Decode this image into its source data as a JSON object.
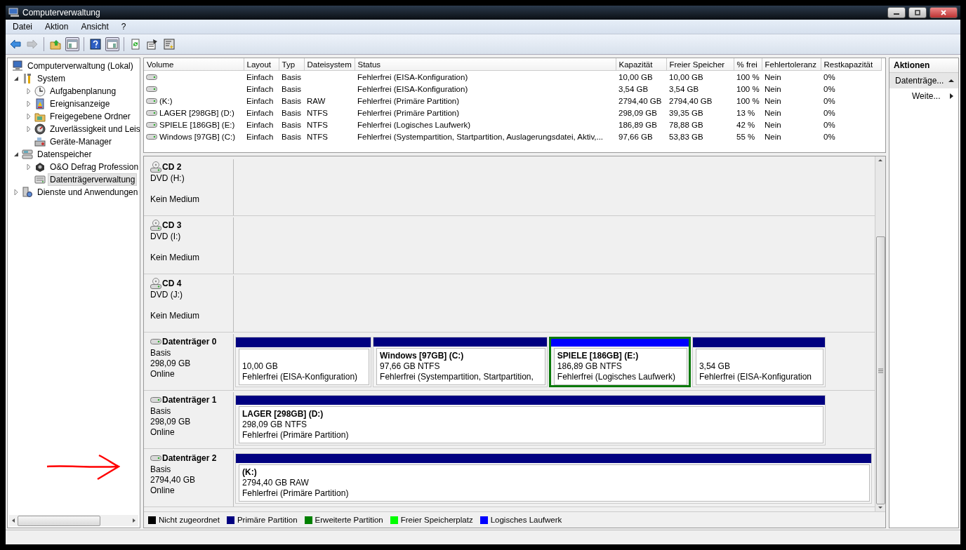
{
  "window": {
    "title": "Computerverwaltung"
  },
  "menu": [
    "Datei",
    "Aktion",
    "Ansicht",
    "?"
  ],
  "toolbar": [
    {
      "pressed": false,
      "disabled": false
    },
    {
      "pressed": false,
      "disabled": true
    },
    {
      "pressed": false,
      "disabled": false
    },
    {
      "pressed": true,
      "disabled": false
    },
    {
      "pressed": false,
      "disabled": false
    },
    {
      "pressed": true,
      "disabled": false
    },
    {
      "pressed": false,
      "disabled": false
    },
    {
      "pressed": false,
      "disabled": false
    },
    {
      "pressed": false,
      "disabled": false
    }
  ],
  "tree": [
    {
      "label": "Computerverwaltung (Lokal)",
      "selected": false,
      "children": [
        {
          "label": "System",
          "expanded": true,
          "selected": false,
          "children": [
            {
              "label": "Aufgabenplanung",
              "expanded": false,
              "selected": false
            },
            {
              "label": "Ereignisanzeige",
              "expanded": false,
              "selected": false
            },
            {
              "label": "Freigegebene Ordner",
              "expanded": false,
              "selected": false
            },
            {
              "label": "Zuverlässigkeit und Leis",
              "expanded": false,
              "selected": false
            },
            {
              "label": "Geräte-Manager",
              "selected": false
            }
          ]
        },
        {
          "label": "Datenspeicher",
          "expanded": true,
          "selected": false,
          "children": [
            {
              "label": "O&O Defrag Profession",
              "expanded": false,
              "selected": false
            },
            {
              "label": "Datenträgerverwaltung",
              "selected": true
            }
          ]
        },
        {
          "label": "Dienste und Anwendungen",
          "expanded": false,
          "selected": false
        }
      ]
    }
  ],
  "volumes": {
    "columns": [
      "Volume",
      "Layout",
      "Typ",
      "Dateisystem",
      "Status",
      "Kapazität",
      "Freier Speicher",
      "% frei",
      "Fehlertoleranz",
      "Restkapazität"
    ],
    "rows": [
      {
        "layout": "Einfach",
        "type": "Basis",
        "status": "Fehlerfrei (EISA-Konfiguration)",
        "capacity": "10,00 GB",
        "free": "10,00 GB",
        "pct_free": "100 %",
        "fault_tolerance": "Nein",
        "overhead": "0%"
      },
      {
        "layout": "Einfach",
        "type": "Basis",
        "status": "Fehlerfrei (EISA-Konfiguration)",
        "capacity": "3,54 GB",
        "free": "3,54 GB",
        "pct_free": "100 %",
        "fault_tolerance": "Nein",
        "overhead": "0%"
      },
      {
        "volume": "(K:)",
        "layout": "Einfach",
        "type": "Basis",
        "fs": "RAW",
        "status": "Fehlerfrei (Primäre Partition)",
        "capacity": "2794,40 GB",
        "free": "2794,40 GB",
        "pct_free": "100 %",
        "fault_tolerance": "Nein",
        "overhead": "0%"
      },
      {
        "volume": "LAGER [298GB] (D:)",
        "layout": "Einfach",
        "type": "Basis",
        "fs": "NTFS",
        "status": "Fehlerfrei (Primäre Partition)",
        "capacity": "298,09 GB",
        "free": "39,35 GB",
        "pct_free": "13 %",
        "fault_tolerance": "Nein",
        "overhead": "0%"
      },
      {
        "volume": "SPIELE [186GB] (E:)",
        "layout": "Einfach",
        "type": "Basis",
        "fs": "NTFS",
        "status": "Fehlerfrei (Logisches Laufwerk)",
        "capacity": "186,89 GB",
        "free": "78,88 GB",
        "pct_free": "42 %",
        "fault_tolerance": "Nein",
        "overhead": "0%"
      },
      {
        "volume": "Windows [97GB] (C:)",
        "layout": "Einfach",
        "type": "Basis",
        "fs": "NTFS",
        "status": "Fehlerfrei (Systempartition, Startpartition, Auslagerungsdatei, Aktiv,...",
        "capacity": "97,66 GB",
        "free": "53,83 GB",
        "pct_free": "55 %",
        "fault_tolerance": "Nein",
        "overhead": "0%"
      }
    ]
  },
  "disks": [
    {
      "kind": "cd",
      "name": "CD 2",
      "type": "DVD (H:)",
      "status": "Kein Medium"
    },
    {
      "kind": "cd",
      "name": "CD 3",
      "type": "DVD (I:)",
      "status": "Kein Medium"
    },
    {
      "kind": "cd",
      "name": "CD 4",
      "type": "DVD (J:)",
      "status": "Kein Medium"
    },
    {
      "kind": "disk",
      "name": "Datenträger 0",
      "type": "Basis",
      "size": "298,09 GB",
      "status": "Online",
      "partitions": [
        {
          "size": "10,00 GB",
          "status": "Fehlerfrei (EISA-Konfiguration)",
          "color": "#000080",
          "selected": false
        },
        {
          "title": "Windows [97GB]  (C:)",
          "size": "97,66 GB NTFS",
          "status": "Fehlerfrei (Systempartition, Startpartition,",
          "color": "#000080",
          "selected": false
        },
        {
          "title": "SPIELE [186GB]  (E:)",
          "size": "186,89 GB NTFS",
          "status": "Fehlerfrei (Logisches Laufwerk)",
          "color": "#0000ff",
          "selected": true
        },
        {
          "size": "3,54 GB",
          "status": "Fehlerfrei (EISA-Konfiguration",
          "color": "#000080",
          "selected": false
        }
      ]
    },
    {
      "kind": "disk",
      "name": "Datenträger 1",
      "type": "Basis",
      "size": "298,09 GB",
      "status": "Online",
      "partitions": [
        {
          "title": "LAGER [298GB]  (D:)",
          "size": "298,09 GB NTFS",
          "status": "Fehlerfrei (Primäre Partition)",
          "color": "#000080",
          "selected": false
        }
      ]
    },
    {
      "kind": "disk",
      "name": "Datenträger 2",
      "type": "Basis",
      "size": "2794,40 GB",
      "status": "Online",
      "partitions": [
        {
          "title": "(K:)",
          "size": "2794,40 GB RAW",
          "status": "Fehlerfrei (Primäre Partition)",
          "color": "#000080",
          "selected": false
        }
      ]
    }
  ],
  "legend": [
    {
      "label": "Nicht zugeordnet",
      "color": "#000000"
    },
    {
      "label": "Primäre Partition",
      "color": "#000080"
    },
    {
      "label": "Erweiterte Partition",
      "color": "#008000"
    },
    {
      "label": "Freier Speicherplatz",
      "color": "#00ff00"
    },
    {
      "label": "Logisches Laufwerk",
      "color": "#0000ff"
    }
  ],
  "actions": {
    "title": "Aktionen",
    "items": [
      {
        "label": "Datenträge...",
        "kind": "section"
      },
      {
        "label": "Weite...",
        "kind": "more"
      }
    ]
  }
}
